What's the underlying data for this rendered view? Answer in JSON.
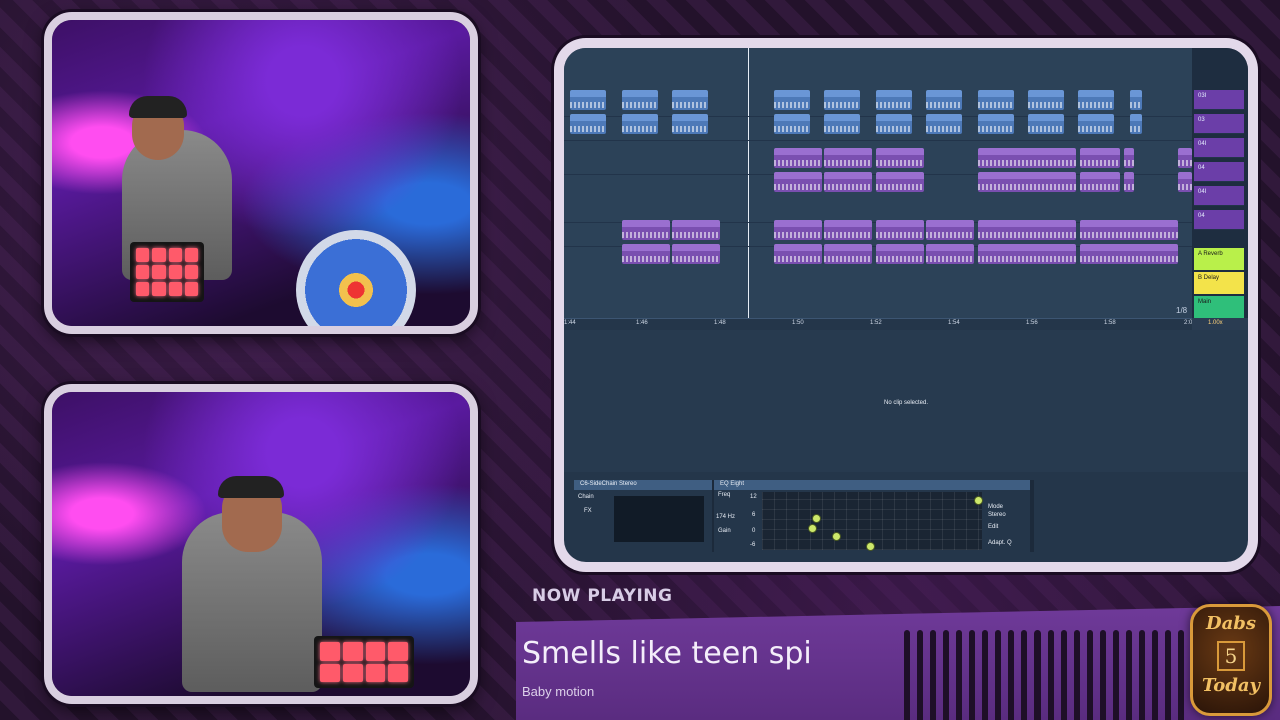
{
  "arrangement": {
    "tracks": [
      {
        "clips": [
          {
            "label": "Mr_Vegas_",
            "color": "blue"
          },
          {
            "label": "Mr_Vegas_",
            "color": "blue"
          },
          {
            "label": "Mr_Vegas_",
            "color": "blue"
          },
          {
            "label": "Mr_Vegas_",
            "color": "blue"
          },
          {
            "label": "Mr_Vegas_",
            "color": "blue"
          },
          {
            "label": "Mr_Vegas_",
            "color": "blue"
          },
          {
            "label": "Mr_Vegas_",
            "color": "blue"
          },
          {
            "label": "Mr_Vegas_",
            "color": "blue"
          },
          {
            "label": "Mr_Vegas_",
            "color": "blue"
          },
          {
            "label": "Mr_Vegas_",
            "color": "blue"
          },
          {
            "label": "Mr_V",
            "color": "blue"
          }
        ]
      },
      {
        "clips": []
      },
      {
        "clips": [
          {
            "label": "VOX_LCH_128_",
            "color": "purple"
          },
          {
            "label": "VOX_LCH_128_",
            "color": "purple"
          },
          {
            "label": "VOX_LCH_128_",
            "color": "purple"
          },
          {
            "label": "VOX_LCH_128_bass_synth_log",
            "color": "purple"
          },
          {
            "label": "VOX_",
            "color": "purple"
          },
          {
            "label": "VOX",
            "color": "purple"
          },
          {
            "label": "VOX_",
            "color": "purple"
          }
        ]
      },
      {
        "clips": []
      },
      {
        "clips": [
          {
            "label": "SquareDown_1:",
            "color": "purple"
          },
          {
            "label": "SquareDown_1:",
            "color": "purple"
          },
          {
            "label": "SquareDown_1:",
            "color": "purple"
          },
          {
            "label": "SquareDown_1:",
            "color": "purple"
          },
          {
            "label": "SquareDown_1:",
            "color": "purple"
          },
          {
            "label": "SquareDown_1:",
            "color": "purple"
          },
          {
            "label": "SquareDown_128_F#_PL_04",
            "color": "purple"
          },
          {
            "label": "SquareDown_128_F#_PL_04",
            "color": "purple"
          }
        ]
      }
    ],
    "timeline": [
      "1:44",
      "1:46",
      "1:48",
      "1:50",
      "1:52",
      "1:54",
      "1:56",
      "1:58",
      "2:00"
    ],
    "loop_fraction": "1/8",
    "mixer": [
      "03I",
      "03",
      "04I",
      "04",
      "04I",
      "04"
    ],
    "returns": [
      {
        "label": "A Reverb",
        "color": "#b9f04a"
      },
      {
        "label": "B Delay",
        "color": "#f3e34a"
      },
      {
        "label": "Main",
        "color": "#2fbf7a"
      }
    ],
    "status": "1.00x"
  },
  "detail": {
    "no_clip": "No clip selected."
  },
  "devices": {
    "sidechain_title": "C6-SideChain Stereo",
    "sidechain_chain": "Chain",
    "sidechain_fx": "FX",
    "eq_title": "EQ Eight",
    "eq_freq_label": "Freq",
    "eq_freq_value": "174 Hz",
    "eq_gain_label": "Gain",
    "eq_scale_top": "12",
    "eq_scale_mid": "6",
    "eq_scale_zero": "0",
    "eq_scale_bot": "-6",
    "eq_mode": "Mode",
    "eq_stereo": "Stereo",
    "eq_edit": "Edit",
    "eq_adapt": "Adapt. Q",
    "eq_points": [
      "1",
      "2",
      "3",
      "4",
      "8"
    ]
  },
  "now_playing": {
    "label": "NOW PLAYING",
    "title": "Smells like teen spir",
    "artist": "Baby motion"
  },
  "badge": {
    "top": "Dabs",
    "number": "5",
    "bottom": "Today"
  },
  "colors": {
    "accent_purple": "#6f3a99",
    "clip_blue": "#4d79b8",
    "clip_purple": "#7a4fb0"
  }
}
